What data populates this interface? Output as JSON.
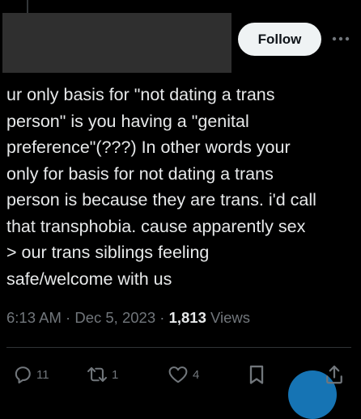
{
  "header": {
    "follow_label": "Follow"
  },
  "tweet": {
    "text": "ur only basis for \"not dating a trans\nperson\" is you having a \"genital\npreference\"(???) In other words your\nonly for basis for not dating a trans\nperson is because they are trans. i'd call\nthat transphobia. cause apparently sex\n> our trans siblings feeling\nsafe/welcome with us",
    "time": "6:13 AM",
    "sep1": " · ",
    "date": "Dec 5, 2023",
    "sep2": " · ",
    "views_count": "1,813",
    "views_label": " Views"
  },
  "actions": {
    "replies": "11",
    "reposts": "1",
    "likes": "4"
  },
  "icons": {
    "more": "more-horizontal-icon",
    "reply": "reply-icon",
    "repost": "repost-icon",
    "like": "heart-icon",
    "bookmark": "bookmark-icon",
    "share": "share-icon"
  },
  "colors": {
    "background": "#000000",
    "text": "#e7e9ea",
    "secondary": "#71767b",
    "accent": "#1d9bf0",
    "follow_bg": "#eff3f4"
  }
}
